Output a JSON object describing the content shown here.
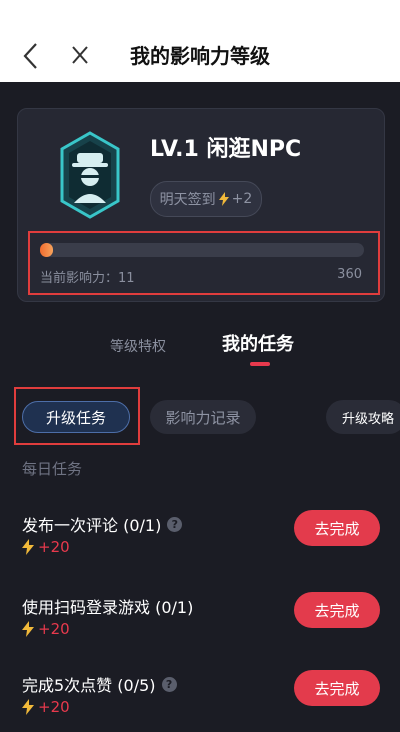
{
  "header": {
    "title": "我的影响力等级"
  },
  "level": {
    "title": "LV.1 闲逛NPC",
    "sign_label": "明天签到",
    "sign_bonus": "+2",
    "current_label": "当前影响力：11",
    "max_value": "360",
    "progress_fraction": 0.03
  },
  "tabs": {
    "privileges": "等级特权",
    "tasks": "我的任务"
  },
  "subtabs": {
    "upgrade": "升级任务",
    "records": "影响力记录",
    "guide": "升级攻略"
  },
  "section": {
    "daily": "每日任务"
  },
  "tasks": [
    {
      "name": "发布一次评论 (0/1)",
      "has_help": true,
      "reward": "+20",
      "button": "去完成"
    },
    {
      "name": "使用扫码登录游戏 (0/1)",
      "has_help": false,
      "reward": "+20",
      "button": "去完成"
    },
    {
      "name": "完成5次点赞 (0/5)",
      "has_help": true,
      "reward": "+20",
      "button": "去完成"
    }
  ],
  "colors": {
    "accent": "#e33b4c",
    "background": "#1b1c24",
    "highlight_box": "#e03d3d"
  }
}
